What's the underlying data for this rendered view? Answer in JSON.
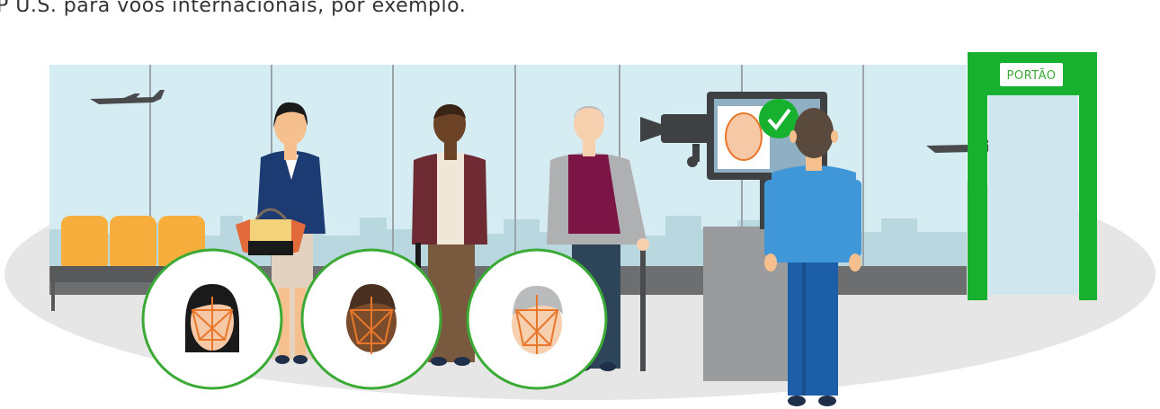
{
  "caption": "P U.S. para voos internacionais, por exemplo.",
  "gate_label": "PORTÃO",
  "colors": {
    "sky": "#d6ecf3",
    "green": "#17b12f",
    "seat": "#f7ae3d",
    "floor": "#e6e6e6",
    "face_mesh": "#e8762b",
    "check": "#17b12f"
  },
  "icons": [
    "airplane-icon",
    "camera-icon",
    "check-icon",
    "face-scan-icon"
  ]
}
